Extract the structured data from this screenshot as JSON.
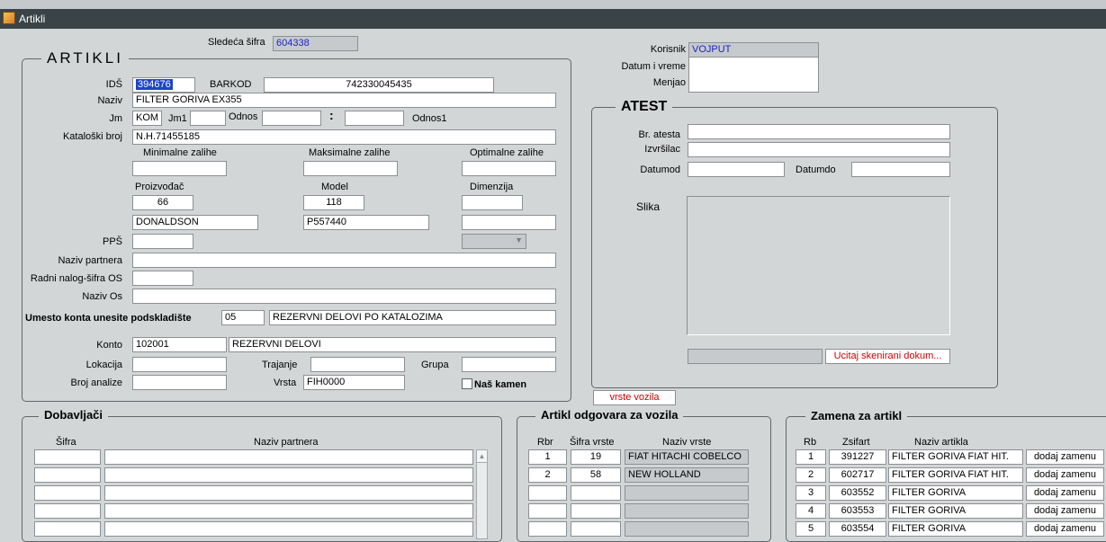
{
  "window": {
    "title": "Artikli",
    "icon": "app-icon"
  },
  "header": {
    "sledeca_sifra_label": "Sledeća šifra",
    "sledeca_sifra_value": "604338",
    "korisnik_label": "Korisnik",
    "korisnik_value": "VOJPUT",
    "datum_label": "Datum i vreme",
    "menjao_label": "Menjao"
  },
  "artikli": {
    "title": "ARTIKLI",
    "ids_label": "IDŠ",
    "ids_value": "394676",
    "barkod_label": "BARKOD",
    "barkod_value": "742330045435",
    "naziv_label": "Naziv",
    "naziv_value": "FILTER GORIVA EX355",
    "jm_label": "Jm",
    "jm_value": "KOM",
    "jm1_label": "Jm1",
    "odnos_label": "Odnos",
    "colon": ":",
    "odnos1_label": "Odnos1",
    "katalog_label": "Kataloški broj",
    "katalog_value": "N.H.71455185",
    "min_label": "Minimalne zalihe",
    "max_label": "Maksimalne zalihe",
    "opt_label": "Optimalne zalihe",
    "proizvodjac_label": "Proizvođač",
    "model_label": "Model",
    "dimenzija_label": "Dimenzija",
    "proizvodjac_code": "66",
    "model_code": "118",
    "proizvodjac_name": "DONALDSON",
    "model_name": "P557440",
    "pps_label": "PPŠ",
    "naziv_partnera_label": "Naziv partnera",
    "radni_nalog_label": "Radni nalog-šifra OS",
    "naziv_os_label": "Naziv Os",
    "umesto_label": "Umesto konta unesite podskladište",
    "podskladiste_code": "05",
    "podskladiste_name": "REZERVNI DELOVI PO KATALOZIMA",
    "konto_label": "Konto",
    "konto_code": "102001",
    "konto_name": "REZERVNI DELOVI",
    "lokacija_label": "Lokacija",
    "trajanje_label": "Trajanje",
    "grupa_label": "Grupa",
    "broj_analize_label": "Broj analize",
    "vrsta_label": "Vrsta",
    "vrsta_value": "FIH0000",
    "nas_kamen_label": "Naš kamen"
  },
  "atest": {
    "title": "ATEST",
    "br_atesta_label": "Br. atesta",
    "izvrsilac_label": "Izvršilac",
    "datumod_label": "Datumod",
    "datumdo_label": "Datumdo",
    "slika_label": "Slika",
    "ucitaj_label": "Ucitaj skenirani dokum..."
  },
  "vrste_vozila_button": "vrste vozila",
  "dobavljaci": {
    "title": "Dobavljači",
    "col_sifra": "Šifra",
    "col_naziv": "Naziv partnera"
  },
  "vozila": {
    "title": "Artikl odgovara za vozila",
    "col_rbr": "Rbr",
    "col_sifra": "Šifra vrste",
    "col_naziv": "Naziv vrste",
    "rows": [
      {
        "rbr": "1",
        "sifra": "19",
        "naziv": "FIAT HITACHI COBELCO"
      },
      {
        "rbr": "2",
        "sifra": "58",
        "naziv": "NEW HOLLAND"
      }
    ]
  },
  "zamena": {
    "title": "Zamena za artikl",
    "col_rb": "Rb",
    "col_zsifart": "Zsifart",
    "col_naziv": "Naziv artikla",
    "button_label": "dodaj zamenu",
    "rows": [
      {
        "rb": "1",
        "zsifart": "391227",
        "naziv": "FILTER GORIVA FIAT HIT."
      },
      {
        "rb": "2",
        "zsifart": "602717",
        "naziv": "FILTER GORIVA FIAT HIT."
      },
      {
        "rb": "3",
        "zsifart": "603552",
        "naziv": "FILTER GORIVA"
      },
      {
        "rb": "4",
        "zsifart": "603553",
        "naziv": "FILTER GORIVA"
      },
      {
        "rb": "5",
        "zsifart": "603554",
        "naziv": "FILTER GORIVA"
      }
    ]
  }
}
